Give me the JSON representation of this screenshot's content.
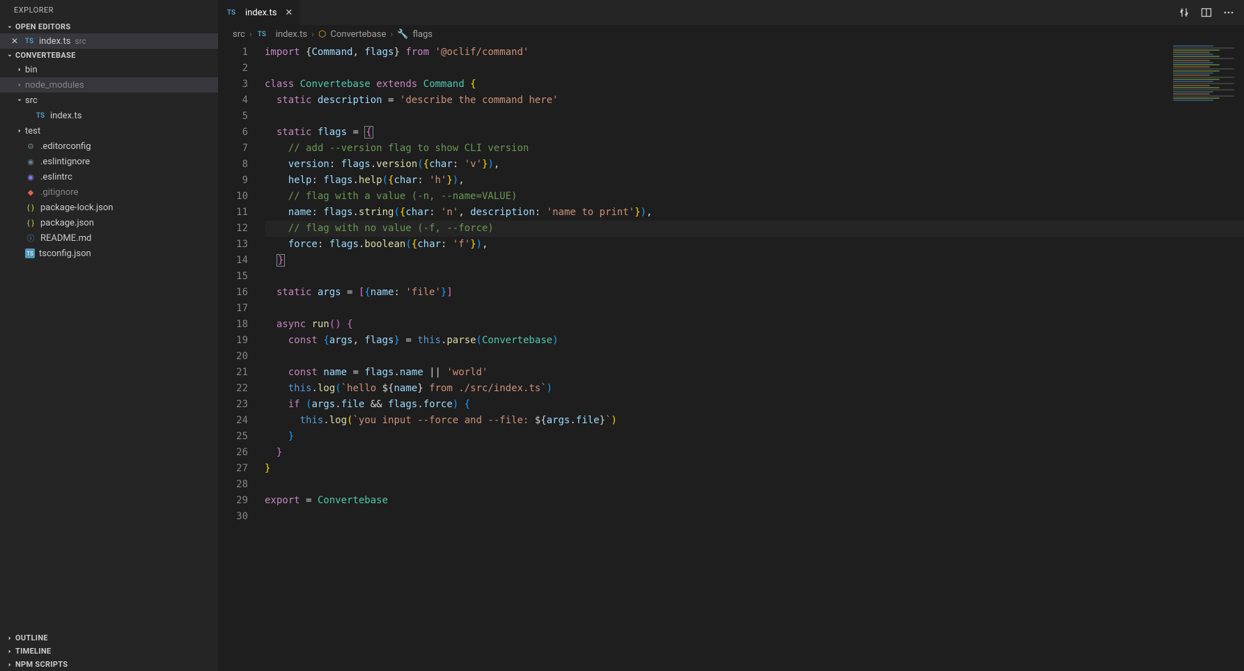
{
  "sidebar": {
    "title": "EXPLORER",
    "openEditors": {
      "label": "OPEN EDITORS",
      "items": [
        {
          "name": "index.ts",
          "hint": "src"
        }
      ]
    },
    "project": {
      "label": "CONVERTEBASE",
      "tree": [
        {
          "type": "folder",
          "name": "bin",
          "expanded": false,
          "indent": 1
        },
        {
          "type": "folder",
          "name": "node_modules",
          "expanded": false,
          "indent": 1,
          "dim": true,
          "highlight": true
        },
        {
          "type": "folder",
          "name": "src",
          "expanded": true,
          "indent": 1
        },
        {
          "type": "file",
          "name": "index.ts",
          "icon": "ts",
          "indent": 2
        },
        {
          "type": "folder",
          "name": "test",
          "expanded": false,
          "indent": 1
        },
        {
          "type": "file",
          "name": ".editorconfig",
          "icon": "gear",
          "indent": 1
        },
        {
          "type": "file",
          "name": ".eslintignore",
          "icon": "ignore",
          "indent": 1
        },
        {
          "type": "file",
          "name": ".eslintrc",
          "icon": "eslint",
          "indent": 1
        },
        {
          "type": "file",
          "name": ".gitignore",
          "icon": "git",
          "indent": 1,
          "dim": true
        },
        {
          "type": "file",
          "name": "package-lock.json",
          "icon": "json",
          "indent": 1
        },
        {
          "type": "file",
          "name": "package.json",
          "icon": "json",
          "indent": 1
        },
        {
          "type": "file",
          "name": "README.md",
          "icon": "info",
          "indent": 1
        },
        {
          "type": "file",
          "name": "tsconfig.json",
          "icon": "tsjson",
          "indent": 1
        }
      ]
    },
    "bottomSections": [
      "OUTLINE",
      "TIMELINE",
      "NPM SCRIPTS"
    ]
  },
  "tab": {
    "name": "index.ts"
  },
  "breadcrumb": [
    "src",
    "index.ts",
    "Convertebase",
    "flags"
  ],
  "code": {
    "lines": [
      [
        [
          "kw",
          "import"
        ],
        [
          "pn",
          " {"
        ],
        [
          "id",
          "Command"
        ],
        [
          "pn",
          ", "
        ],
        [
          "id",
          "flags"
        ],
        [
          "pn",
          "} "
        ],
        [
          "kw",
          "from"
        ],
        [
          "pn",
          " "
        ],
        [
          "str",
          "'@oclif/command'"
        ]
      ],
      [],
      [
        [
          "kw",
          "class"
        ],
        [
          "pn",
          " "
        ],
        [
          "type",
          "Convertebase"
        ],
        [
          "pn",
          " "
        ],
        [
          "kw",
          "extends"
        ],
        [
          "pn",
          " "
        ],
        [
          "type",
          "Command"
        ],
        [
          "pn",
          " "
        ],
        [
          "paren1",
          "{"
        ]
      ],
      [
        [
          "pn",
          "  "
        ],
        [
          "kw",
          "static"
        ],
        [
          "pn",
          " "
        ],
        [
          "id",
          "description"
        ],
        [
          "pn",
          " = "
        ],
        [
          "str",
          "'describe the command here'"
        ]
      ],
      [],
      [
        [
          "pn",
          "  "
        ],
        [
          "kw",
          "static"
        ],
        [
          "pn",
          " "
        ],
        [
          "id",
          "flags"
        ],
        [
          "pn",
          " = "
        ],
        [
          "paren2 box",
          "{"
        ]
      ],
      [
        [
          "pn",
          "    "
        ],
        [
          "cm",
          "// add --version flag to show CLI version"
        ]
      ],
      [
        [
          "pn",
          "    "
        ],
        [
          "id",
          "version"
        ],
        [
          "pn",
          ": "
        ],
        [
          "id",
          "flags"
        ],
        [
          "pn",
          "."
        ],
        [
          "fn",
          "version"
        ],
        [
          "paren3",
          "("
        ],
        [
          "paren1",
          "{"
        ],
        [
          "id",
          "char"
        ],
        [
          "pn",
          ": "
        ],
        [
          "str",
          "'v'"
        ],
        [
          "paren1",
          "}"
        ],
        [
          "paren3",
          ")"
        ],
        [
          "pn",
          ","
        ]
      ],
      [
        [
          "pn",
          "    "
        ],
        [
          "id",
          "help"
        ],
        [
          "pn",
          ": "
        ],
        [
          "id",
          "flags"
        ],
        [
          "pn",
          "."
        ],
        [
          "fn",
          "help"
        ],
        [
          "paren3",
          "("
        ],
        [
          "paren1",
          "{"
        ],
        [
          "id",
          "char"
        ],
        [
          "pn",
          ": "
        ],
        [
          "str",
          "'h'"
        ],
        [
          "paren1",
          "}"
        ],
        [
          "paren3",
          ")"
        ],
        [
          "pn",
          ","
        ]
      ],
      [
        [
          "pn",
          "    "
        ],
        [
          "cm",
          "// flag with a value (-n, --name=VALUE)"
        ]
      ],
      [
        [
          "pn",
          "    "
        ],
        [
          "id",
          "name"
        ],
        [
          "pn",
          ": "
        ],
        [
          "id",
          "flags"
        ],
        [
          "pn",
          "."
        ],
        [
          "fn",
          "string"
        ],
        [
          "paren3",
          "("
        ],
        [
          "paren1",
          "{"
        ],
        [
          "id",
          "char"
        ],
        [
          "pn",
          ": "
        ],
        [
          "str",
          "'n'"
        ],
        [
          "pn",
          ", "
        ],
        [
          "id",
          "description"
        ],
        [
          "pn",
          ": "
        ],
        [
          "str",
          "'name to print'"
        ],
        [
          "paren1",
          "}"
        ],
        [
          "paren3",
          ")"
        ],
        [
          "pn",
          ","
        ]
      ],
      [
        [
          "pn",
          "    "
        ],
        [
          "cm",
          "// flag with no value (-f, --force)"
        ]
      ],
      [
        [
          "pn",
          "    "
        ],
        [
          "id",
          "force"
        ],
        [
          "pn",
          ": "
        ],
        [
          "id",
          "flags"
        ],
        [
          "pn",
          "."
        ],
        [
          "fn",
          "boolean"
        ],
        [
          "paren3",
          "("
        ],
        [
          "paren1",
          "{"
        ],
        [
          "id",
          "char"
        ],
        [
          "pn",
          ": "
        ],
        [
          "str",
          "'f'"
        ],
        [
          "paren1",
          "}"
        ],
        [
          "paren3",
          ")"
        ],
        [
          "pn",
          ","
        ]
      ],
      [
        [
          "pn",
          "  "
        ],
        [
          "paren2 box",
          "}"
        ]
      ],
      [],
      [
        [
          "pn",
          "  "
        ],
        [
          "kw",
          "static"
        ],
        [
          "pn",
          " "
        ],
        [
          "id",
          "args"
        ],
        [
          "pn",
          " = "
        ],
        [
          "paren2",
          "["
        ],
        [
          "paren3",
          "{"
        ],
        [
          "id",
          "name"
        ],
        [
          "pn",
          ": "
        ],
        [
          "str",
          "'file'"
        ],
        [
          "paren3",
          "}"
        ],
        [
          "paren2",
          "]"
        ]
      ],
      [],
      [
        [
          "pn",
          "  "
        ],
        [
          "kw",
          "async"
        ],
        [
          "pn",
          " "
        ],
        [
          "fn",
          "run"
        ],
        [
          "paren2",
          "("
        ],
        [
          "paren2",
          ")"
        ],
        [
          "pn",
          " "
        ],
        [
          "paren2",
          "{"
        ]
      ],
      [
        [
          "pn",
          "    "
        ],
        [
          "kw",
          "const"
        ],
        [
          "pn",
          " "
        ],
        [
          "paren3",
          "{"
        ],
        [
          "id",
          "args"
        ],
        [
          "pn",
          ", "
        ],
        [
          "id",
          "flags"
        ],
        [
          "paren3",
          "}"
        ],
        [
          "pn",
          " = "
        ],
        [
          "this",
          "this"
        ],
        [
          "pn",
          "."
        ],
        [
          "fn",
          "parse"
        ],
        [
          "paren3",
          "("
        ],
        [
          "type",
          "Convertebase"
        ],
        [
          "paren3",
          ")"
        ]
      ],
      [],
      [
        [
          "pn",
          "    "
        ],
        [
          "kw",
          "const"
        ],
        [
          "pn",
          " "
        ],
        [
          "id",
          "name"
        ],
        [
          "pn",
          " = "
        ],
        [
          "id",
          "flags"
        ],
        [
          "pn",
          "."
        ],
        [
          "id",
          "name"
        ],
        [
          "pn",
          " || "
        ],
        [
          "str",
          "'world'"
        ]
      ],
      [
        [
          "pn",
          "    "
        ],
        [
          "this",
          "this"
        ],
        [
          "pn",
          "."
        ],
        [
          "fn",
          "log"
        ],
        [
          "paren3",
          "("
        ],
        [
          "str",
          "`hello "
        ],
        [
          "pn",
          "${"
        ],
        [
          "id",
          "name"
        ],
        [
          "pn",
          "}"
        ],
        [
          "str",
          " from ./src/index.ts`"
        ],
        [
          "paren3",
          ")"
        ]
      ],
      [
        [
          "pn",
          "    "
        ],
        [
          "kw",
          "if"
        ],
        [
          "pn",
          " "
        ],
        [
          "paren3",
          "("
        ],
        [
          "id",
          "args"
        ],
        [
          "pn",
          "."
        ],
        [
          "id",
          "file"
        ],
        [
          "pn",
          " && "
        ],
        [
          "id",
          "flags"
        ],
        [
          "pn",
          "."
        ],
        [
          "id",
          "force"
        ],
        [
          "paren3",
          ")"
        ],
        [
          "pn",
          " "
        ],
        [
          "paren3",
          "{"
        ]
      ],
      [
        [
          "pn",
          "      "
        ],
        [
          "this",
          "this"
        ],
        [
          "pn",
          "."
        ],
        [
          "fn",
          "log"
        ],
        [
          "paren1",
          "("
        ],
        [
          "str",
          "`you input --force and --file: "
        ],
        [
          "pn",
          "${"
        ],
        [
          "id",
          "args"
        ],
        [
          "pn",
          "."
        ],
        [
          "id",
          "file"
        ],
        [
          "pn",
          "}"
        ],
        [
          "str",
          "`"
        ],
        [
          "paren1",
          ")"
        ]
      ],
      [
        [
          "pn",
          "    "
        ],
        [
          "paren3",
          "}"
        ]
      ],
      [
        [
          "pn",
          "  "
        ],
        [
          "paren2",
          "}"
        ]
      ],
      [
        [
          "paren1",
          "}"
        ]
      ],
      [],
      [
        [
          "kw",
          "export"
        ],
        [
          "pn",
          " = "
        ],
        [
          "type",
          "Convertebase"
        ]
      ],
      []
    ],
    "highlightLine": 12
  }
}
